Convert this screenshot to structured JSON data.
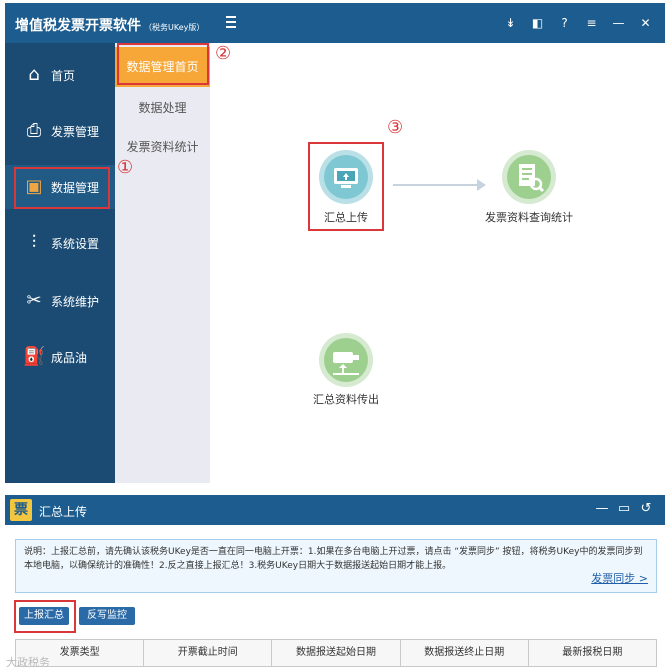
{
  "app": {
    "title": "增值税发票开票软件",
    "subtitle": "（税务UKey版）",
    "toolbar_icons": [
      "download-icon",
      "screen-icon",
      "help-icon",
      "menu-icon",
      "minimize-icon",
      "close-icon"
    ],
    "toolbar_glyphs": [
      "↡",
      "◧",
      "?",
      "≡",
      "—",
      "✕"
    ]
  },
  "sidebar": {
    "items": [
      {
        "label": "首页",
        "icon": "home-icon",
        "glyph": "⌂"
      },
      {
        "label": "发票管理",
        "icon": "printer-icon",
        "glyph": "⎙"
      },
      {
        "label": "数据管理",
        "icon": "box-icon",
        "glyph": "▣"
      },
      {
        "label": "系统设置",
        "icon": "sliders-icon",
        "glyph": "⫶"
      },
      {
        "label": "系统维护",
        "icon": "tools-icon",
        "glyph": "✂"
      },
      {
        "label": "成品油",
        "icon": "oil-can-icon",
        "glyph": "⛽"
      }
    ]
  },
  "subnav": {
    "items": [
      {
        "label": "数据管理首页"
      },
      {
        "label": "数据处理"
      },
      {
        "label": "发票资料统计"
      }
    ]
  },
  "main": {
    "features": [
      {
        "label": "汇总上传",
        "icon": "upload-summary-icon"
      },
      {
        "label": "发票资料查询统计",
        "icon": "invoice-query-icon"
      },
      {
        "label": "汇总资料传出",
        "icon": "export-summary-icon"
      }
    ]
  },
  "annotations": {
    "one": "①",
    "two": "②",
    "three": "③"
  },
  "window2": {
    "logo": "票",
    "title": "汇总上传",
    "controls": [
      "—",
      "▭",
      "↺"
    ],
    "notice_text": "说明：上报汇总前，请先确认该税务UKey是否一直在同一电脑上开票：1.如果在多台电脑上开过票，请点击 “发票同步” 按钮，将税务UKey中的发票同步到本地电脑，以确保统计的准确性！2.反之直接上报汇总！3.税务UKey日期大于数据报送起始日期才能上报。",
    "sync_link": "发票同步 >",
    "buttons": {
      "report": "上报汇总",
      "reverse": "反写监控"
    },
    "table_headers": [
      "发票类型",
      "开票截止时间",
      "数据报送起始日期",
      "数据报送终止日期",
      "最新报税日期"
    ]
  },
  "watermark": "大政税务"
}
